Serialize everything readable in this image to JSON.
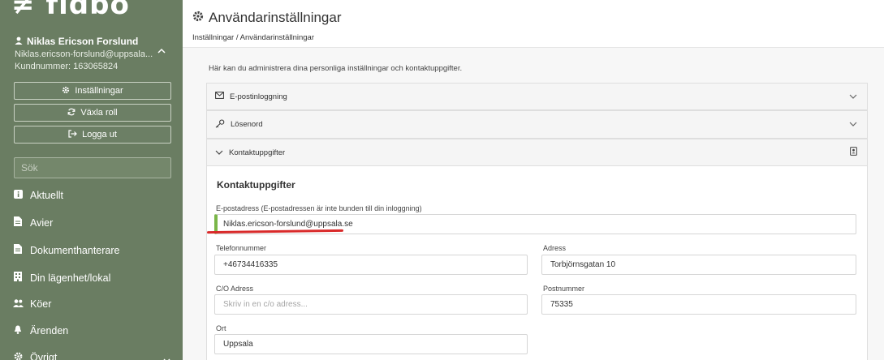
{
  "sidebar": {
    "logo": "≠ fidbo",
    "user": {
      "name": "Niklas Ericson Forslund",
      "email": "Niklas.ericson-forslund@uppsala...",
      "customer_number": "Kundnummer: 163065824",
      "toggle_icon": "chevron-up-icon"
    },
    "buttons": {
      "settings": "Inställningar",
      "switch_role": "Växla roll",
      "logout": "Logga ut"
    },
    "search": {
      "placeholder": "Sök"
    },
    "nav": [
      {
        "label": "Aktuellt",
        "icon": "info-icon"
      },
      {
        "label": "Avier",
        "icon": "document-icon"
      },
      {
        "label": "Dokumenthanterare",
        "icon": "file-icon"
      },
      {
        "label": "Din lägenhet/lokal",
        "icon": "building-icon"
      },
      {
        "label": "Köer",
        "icon": "users-icon"
      },
      {
        "label": "Ärenden",
        "icon": "bell-icon"
      },
      {
        "label": "Övrigt",
        "icon": "gear-icon"
      }
    ]
  },
  "header": {
    "title": "Användarinställningar",
    "breadcrumb": "Inställningar / Användarinställningar"
  },
  "main": {
    "intro": "Här kan du administrera dina personliga inställningar och kontaktuppgifter.",
    "accordions": [
      {
        "label": "E-postinloggning",
        "icon": "envelope-icon",
        "expanded": false
      },
      {
        "label": "Lösenord",
        "icon": "key-icon",
        "expanded": false
      },
      {
        "label": "Kontaktuppgifter",
        "icon": "contact-card-icon",
        "expanded": true
      }
    ],
    "contact": {
      "title": "Kontaktuppgifter",
      "email": {
        "label": "E-postadress (E-postadressen är inte bunden till din inloggning)",
        "value": "Niklas.ericson-forslund@uppsala.se"
      },
      "phone": {
        "label": "Telefonnummer",
        "value": "+46734416335"
      },
      "address": {
        "label": "Adress",
        "value": "Torbjörnsgatan 10"
      },
      "co_address": {
        "label": "C/O Adress",
        "placeholder": "Skriv in en c/o adress..."
      },
      "postal_code": {
        "label": "Postnummer",
        "value": "75335"
      },
      "city": {
        "label": "Ort",
        "value": "Uppsala"
      }
    }
  },
  "colors": {
    "sidebar_bg": "#6a7d62",
    "valid_accent": "#7ab648",
    "annotation_red": "#d92a2a"
  }
}
